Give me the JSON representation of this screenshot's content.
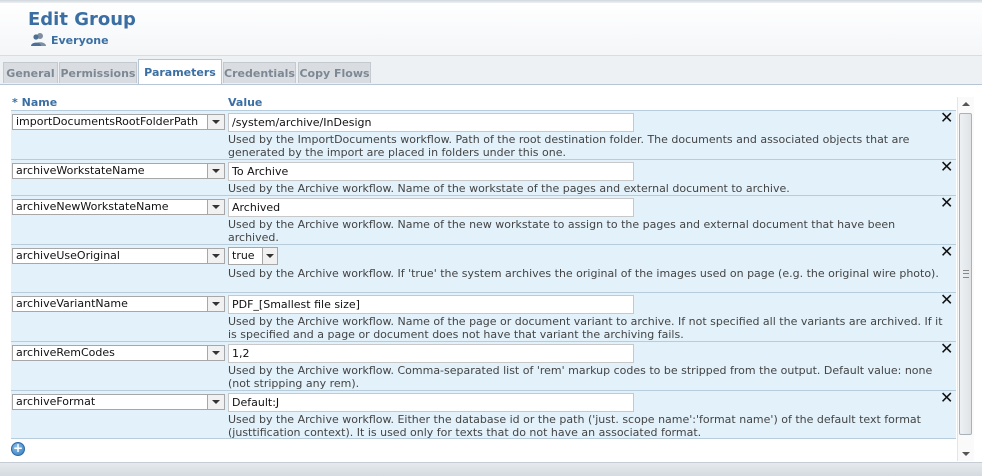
{
  "header": {
    "title": "Edit Group",
    "group_name": "Everyone"
  },
  "tabs": [
    {
      "label": "General",
      "active": false
    },
    {
      "label": "Permissions",
      "active": false
    },
    {
      "label": "Parameters",
      "active": true
    },
    {
      "label": "Credentials",
      "active": false
    },
    {
      "label": "Copy Flows",
      "active": false
    }
  ],
  "columns": {
    "required_marker": "*",
    "name": "Name",
    "value": "Value"
  },
  "rows": [
    {
      "name": "importDocumentsRootFolderPath",
      "value": "/system/archive/InDesign",
      "description": "Used by the ImportDocuments workflow. Path of the root destination folder. The documents and associated objects that are generated by the import are placed in folders under this one."
    },
    {
      "name": "archiveWorkstateName",
      "value": "To Archive",
      "description": "Used by the Archive workflow. Name of the workstate of the pages and external document to archive."
    },
    {
      "name": "archiveNewWorkstateName",
      "value": "Archived",
      "description": "Used by the Archive workflow. Name of the new workstate to assign to the pages and external document that have been archived."
    },
    {
      "name": "archiveUseOriginal",
      "value": "true",
      "description": "Used by the Archive workflow. If 'true' the system archives the original of the images used on page (e.g. the original wire photo)."
    },
    {
      "name": "archiveVariantName",
      "value": "PDF_[Smallest file size]",
      "description": "Used by the Archive workflow. Name of the page or document variant to archive. If not specified all the variants are archived. If it is specified and a page or document does not have that variant the archiving fails."
    },
    {
      "name": "archiveRemCodes",
      "value": "1,2",
      "description": "Used by the Archive workflow. Comma-separated list of 'rem' markup codes to be stripped from the output. Default value: none (not stripping any rem)."
    },
    {
      "name": "archiveFormat",
      "value": "Default:J",
      "description": "Used by the Archive workflow. Either the database id or the path ('just. scope name':'format name') of the default text format (justtification context). It is used only for texts that do not have an associated format."
    }
  ],
  "delete_glyph": "✕",
  "icons": {
    "group": "user-group-icon",
    "delete": "close-icon",
    "add": "add-circle-icon"
  },
  "colors": {
    "accent": "#3b6fa3",
    "row_background": "#e2f1fa"
  }
}
